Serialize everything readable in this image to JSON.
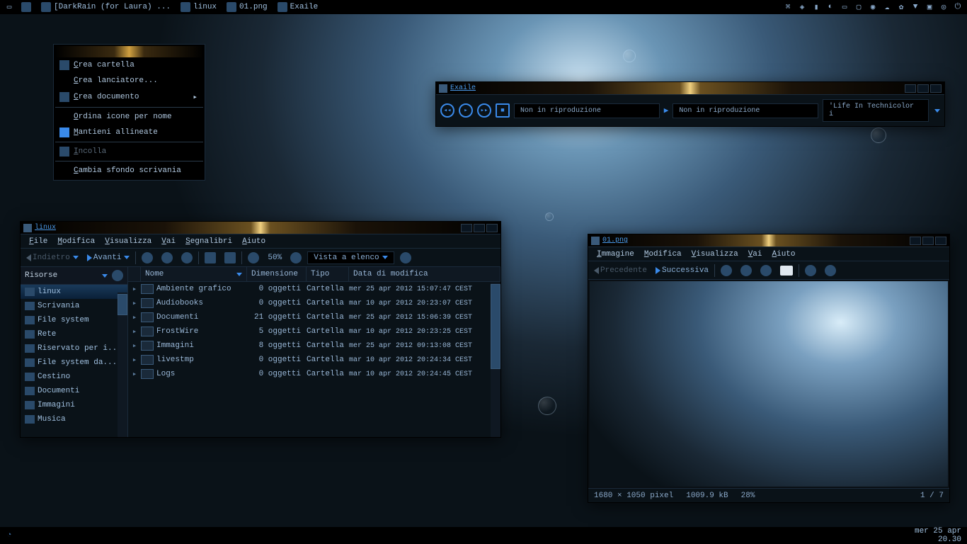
{
  "taskbar": {
    "items": [
      {
        "label": "[DarkRain (for Laura) ..."
      },
      {
        "label": "linux"
      },
      {
        "label": "01.png"
      },
      {
        "label": "Exaile"
      }
    ]
  },
  "bottombar": {
    "date": "mer 25 apr",
    "time": "20.30"
  },
  "context_menu": {
    "items": [
      {
        "label": "Crea cartella",
        "icon": "folder-new",
        "sub": false
      },
      {
        "label": "Crea lanciatore...",
        "sub": false
      },
      {
        "label": "Crea documento",
        "icon": "doc",
        "sub": true
      },
      {
        "sep": true
      },
      {
        "label": "Ordina icone per nome",
        "sub": false
      },
      {
        "label": "Mantieni allineate",
        "icon": "check",
        "sub": false
      },
      {
        "sep": true
      },
      {
        "label": "Incolla",
        "disabled": true,
        "icon": "paste",
        "sub": false
      },
      {
        "sep": true
      },
      {
        "label": "Cambia sfondo scrivania",
        "sub": false
      }
    ]
  },
  "exaile": {
    "title": "Exaile",
    "now_playing": "Non in riproduzione",
    "track2": "Non in riproduzione",
    "queued": "'Life In Technicolor i"
  },
  "fm": {
    "title": "linux",
    "menus": [
      "File",
      "Modifica",
      "Visualizza",
      "Vai",
      "Segnalibri",
      "Aiuto"
    ],
    "nav": {
      "back": "Indietro",
      "forward": "Avanti",
      "zoom": "50%",
      "view": "Vista a elenco"
    },
    "sidebar_header": "Risorse",
    "sidebar": [
      {
        "label": "linux",
        "sel": true
      },
      {
        "label": "Scrivania"
      },
      {
        "label": "File system"
      },
      {
        "label": "Rete"
      },
      {
        "label": "Riservato per i..."
      },
      {
        "label": "File system da..."
      },
      {
        "label": "Cestino"
      },
      {
        "label": "Documenti"
      },
      {
        "label": "Immagini"
      },
      {
        "label": "Musica"
      }
    ],
    "columns": [
      "Nome",
      "Dimensione",
      "Tipo",
      "Data di modifica"
    ],
    "rows": [
      {
        "name": "Ambiente grafico",
        "size": "0 oggetti",
        "type": "Cartella",
        "date": "mer 25 apr 2012 15:07:47 CEST"
      },
      {
        "name": "Audiobooks",
        "size": "0 oggetti",
        "type": "Cartella",
        "date": "mar 10 apr 2012 20:23:07 CEST"
      },
      {
        "name": "Documenti",
        "size": "21 oggetti",
        "type": "Cartella",
        "date": "mer 25 apr 2012 15:06:39 CEST"
      },
      {
        "name": "FrostWire",
        "size": "5 oggetti",
        "type": "Cartella",
        "date": "mar 10 apr 2012 20:23:25 CEST"
      },
      {
        "name": "Immagini",
        "size": "8 oggetti",
        "type": "Cartella",
        "date": "mer 25 apr 2012 09:13:08 CEST"
      },
      {
        "name": "livestmp",
        "size": "0 oggetti",
        "type": "Cartella",
        "date": "mar 10 apr 2012 20:24:34 CEST"
      },
      {
        "name": "Logs",
        "size": "0 oggetti",
        "type": "Cartella",
        "date": "mar 10 apr 2012 20:24:45 CEST"
      }
    ]
  },
  "iv": {
    "title": "01.png",
    "menus": [
      "Immagine",
      "Modifica",
      "Visualizza",
      "Vai",
      "Aiuto"
    ],
    "nav": {
      "prev": "Precedente",
      "next": "Successiva"
    },
    "status": {
      "dims": "1680 × 1050 pixel",
      "size": "1009.9 kB",
      "zoom": "28%",
      "pos": "1 / 7"
    }
  }
}
